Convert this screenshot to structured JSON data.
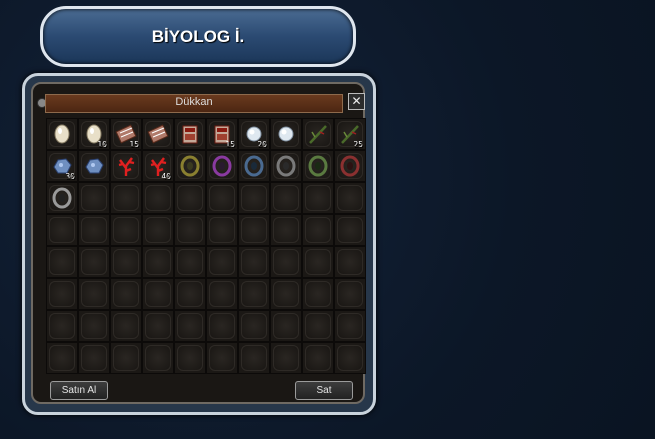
{
  "npc": {
    "title": "BİYOLOG İ."
  },
  "window": {
    "title": "Dükkan",
    "close_label": "✕"
  },
  "buttons": {
    "buy": "Satın Al",
    "sell": "Sat"
  },
  "slots": [
    {
      "icon": "bone-item-icon",
      "count": ""
    },
    {
      "icon": "bone-item-icon",
      "count": "10"
    },
    {
      "icon": "red-scroll-icon",
      "count": "15"
    },
    {
      "icon": "red-scroll-icon",
      "count": ""
    },
    {
      "icon": "red-book-icon",
      "count": ""
    },
    {
      "icon": "red-book-icon",
      "count": "15"
    },
    {
      "icon": "white-crystal-icon",
      "count": "20"
    },
    {
      "icon": "white-crystal-icon",
      "count": ""
    },
    {
      "icon": "green-branch-icon",
      "count": ""
    },
    {
      "icon": "green-branch-icon",
      "count": "25"
    },
    {
      "icon": "blue-ore-icon",
      "count": "30"
    },
    {
      "icon": "blue-ore-icon",
      "count": ""
    },
    {
      "icon": "red-coral-icon",
      "count": ""
    },
    {
      "icon": "red-coral-icon",
      "count": "40"
    },
    {
      "icon": "gold-ring-icon",
      "count": ""
    },
    {
      "icon": "purple-ring-icon",
      "count": ""
    },
    {
      "icon": "blue-ring-icon",
      "count": ""
    },
    {
      "icon": "grey-ring-icon",
      "count": ""
    },
    {
      "icon": "green-ring-icon",
      "count": ""
    },
    {
      "icon": "red-ring-icon",
      "count": ""
    },
    {
      "icon": "silver-ring-icon",
      "count": ""
    }
  ],
  "total_slots": 80,
  "colors": {
    "banner": "#2b4a72",
    "titlebar": "#6a3a1e",
    "slot": "#1f1c19"
  }
}
